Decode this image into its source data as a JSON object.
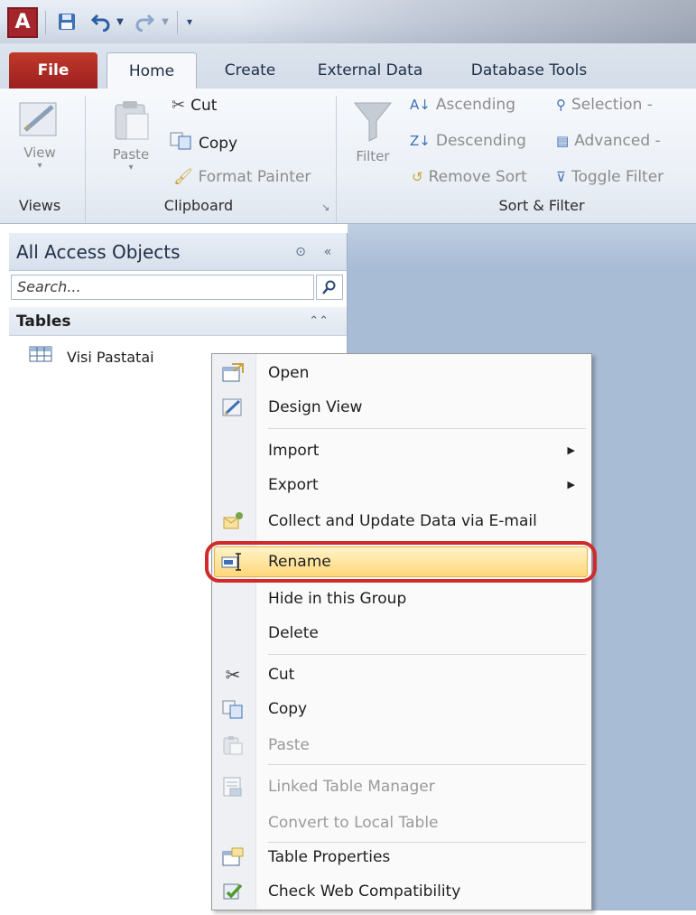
{
  "quick_access": {
    "app_icon": "A"
  },
  "tabs": [
    {
      "label": "File"
    },
    {
      "label": "Home"
    },
    {
      "label": "Create"
    },
    {
      "label": "External Data"
    },
    {
      "label": "Database Tools"
    }
  ],
  "ribbon": {
    "views": {
      "view_label": "View",
      "group_label": "Views"
    },
    "clipboard": {
      "paste_label": "Paste",
      "cut_label": "Cut",
      "copy_label": "Copy",
      "format_painter_label": "Format Painter",
      "group_label": "Clipboard"
    },
    "sort_filter": {
      "filter_label": "Filter",
      "ascending_label": "Ascending",
      "descending_label": "Descending",
      "remove_sort_label": "Remove Sort",
      "selection_label": "Selection -",
      "advanced_label": "Advanced -",
      "toggle_filter_label": "Toggle Filter",
      "group_label": "Sort & Filter"
    }
  },
  "nav_pane": {
    "title": "All Access Objects",
    "search_placeholder": "Search...",
    "group_label": "Tables",
    "items": [
      {
        "label": "Visi Pastatai"
      }
    ]
  },
  "context_menu": {
    "items": [
      {
        "id": "open",
        "label": "Open",
        "icon": "open-icon",
        "enabled": true
      },
      {
        "id": "design_view",
        "label": "Design View",
        "icon": "design-view-icon",
        "enabled": true
      },
      {
        "id": "import",
        "label": "Import",
        "submenu": true,
        "enabled": true
      },
      {
        "id": "export",
        "label": "Export",
        "submenu": true,
        "enabled": true
      },
      {
        "id": "collect",
        "label": "Collect and Update Data via E-mail",
        "icon": "collect-data-icon",
        "enabled": true
      },
      {
        "id": "rename",
        "label": "Rename",
        "icon": "rename-icon",
        "enabled": true,
        "highlighted": true
      },
      {
        "id": "hide",
        "label": "Hide in this Group",
        "enabled": true
      },
      {
        "id": "delete",
        "label": "Delete",
        "enabled": true
      },
      {
        "id": "cut",
        "label": "Cut",
        "icon": "cut-icon",
        "enabled": true
      },
      {
        "id": "copy",
        "label": "Copy",
        "icon": "copy-icon",
        "enabled": true
      },
      {
        "id": "paste",
        "label": "Paste",
        "icon": "paste-icon",
        "enabled": false
      },
      {
        "id": "linked",
        "label": "Linked Table Manager",
        "icon": "linked-table-icon",
        "enabled": false
      },
      {
        "id": "convert",
        "label": "Convert to Local Table",
        "enabled": false
      },
      {
        "id": "props",
        "label": "Table Properties",
        "icon": "table-properties-icon",
        "enabled": true
      },
      {
        "id": "webcheck",
        "label": "Check Web Compatibility",
        "icon": "web-compat-icon",
        "enabled": true
      }
    ]
  },
  "colors": {
    "file_tab": "#b22a25",
    "highlight": "#ffd77a",
    "callout": "#d12a2a",
    "workspace": "#a9bcd5"
  }
}
